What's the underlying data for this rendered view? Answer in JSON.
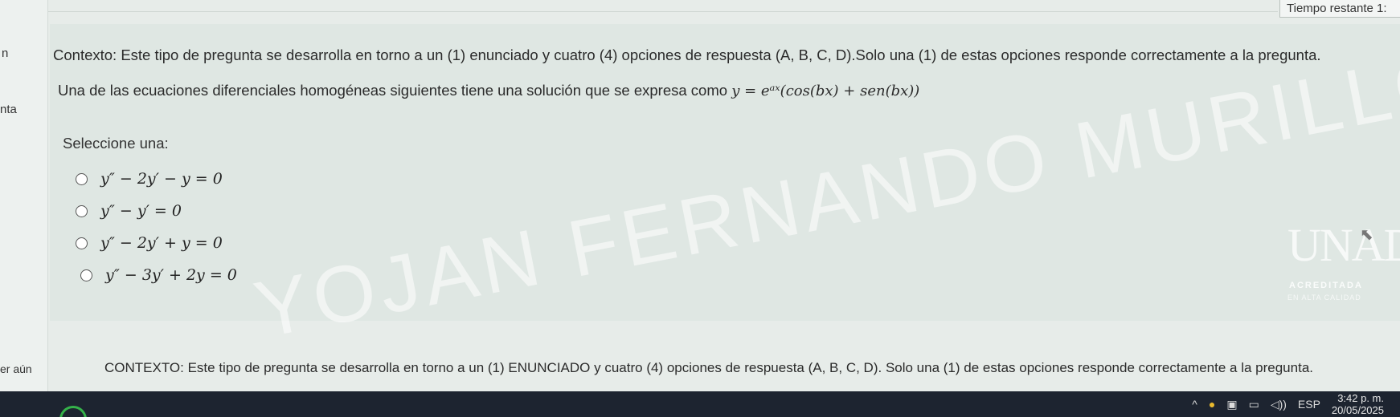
{
  "timer": {
    "label": "Tiempo restante 1:"
  },
  "left_strip": {
    "fragment_top": "n",
    "fragment_mid": "nta",
    "fragment_bottom": "er aún"
  },
  "question": {
    "context": "Contexto: Este tipo de pregunta se desarrolla en torno a un (1) enunciado y cuatro (4) opciones de respuesta (A, B, C, D).Solo una (1) de estas opciones responde correctamente a la pregunta.",
    "stem_prefix": "Una de las ecuaciones diferenciales homogéneas siguientes tiene una solución que se expresa como",
    "stem_formula": "y = eᵃˣ(cos(bx) + sen(bx))",
    "select_label": "Seleccione una:",
    "options": [
      {
        "label": "y″ − 2y′ − y = 0"
      },
      {
        "label": "y″ − y′ = 0"
      },
      {
        "label": "y″ − 2y′ + y = 0"
      },
      {
        "label": "y″ − 3y′ + 2y = 0"
      }
    ]
  },
  "watermark": {
    "text": "YOJAN FERNANDO MURILLO PINTO"
  },
  "logo": {
    "letters": "UNAD",
    "acreditada": "ACREDITADA",
    "sub": "EN ALTA CALIDAD"
  },
  "next_question": {
    "context": "CONTEXTO: Este tipo de pregunta se desarrolla en torno a un (1) ENUNCIADO y cuatro (4) opciones de respuesta (A, B, C, D). Solo una (1) de estas opciones responde correctamente a la pregunta."
  },
  "taskbar": {
    "tray_chevron": "^",
    "language": "ESP",
    "time": "3:42 p. m.",
    "date": "20/05/2025",
    "colors": {
      "app_ring": "#35b24a",
      "bg": "#1d2430"
    }
  }
}
